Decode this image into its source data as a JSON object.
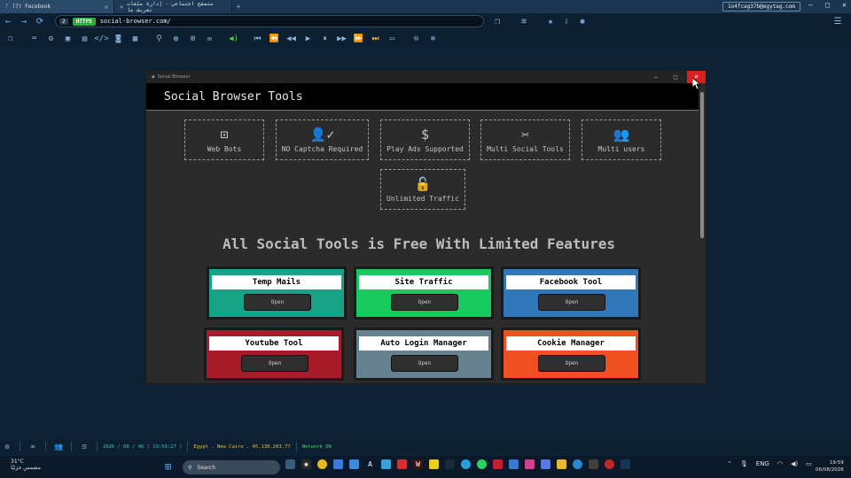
{
  "browser": {
    "tabs": [
      {
        "label": "(7) Facebook"
      },
      {
        "label": "متصفح اجتماعي - إدارة ملفات تعريف ما"
      }
    ],
    "new_tab": "+",
    "email": "1o4fcag37b@egytag.com",
    "url": {
      "tab_number": "2",
      "badge": "HTTPS",
      "text": "social-browser.com/"
    }
  },
  "window": {
    "app_name": "Social Browser",
    "header": "Social Browser Tools",
    "features": [
      {
        "icon": "robot-icon",
        "label": "Web Bots"
      },
      {
        "icon": "user-check-icon",
        "label": "NO Captcha Required"
      },
      {
        "icon": "dollar-file-icon",
        "label": "Play Ads Supported"
      },
      {
        "icon": "tools-icon",
        "label": "Multi Social Tools"
      },
      {
        "icon": "users-icon",
        "label": "Multi users"
      },
      {
        "icon": "unlock-icon",
        "label": "Unlimited Traffic"
      }
    ],
    "title": "All Social Tools is Free With Limited Features",
    "tools": [
      {
        "name": "Temp Mails",
        "button": "Open",
        "color": "#16a388"
      },
      {
        "name": "Site Traffic",
        "button": "Open",
        "color": "#18c95e"
      },
      {
        "name": "Facebook Tool",
        "button": "Open",
        "color": "#2f77b8"
      },
      {
        "name": "Youtube Tool",
        "button": "Open",
        "color": "#a81b2a"
      },
      {
        "name": "Auto Login Manager",
        "button": "Open",
        "color": "#65808f"
      },
      {
        "name": "Cookie Manager",
        "button": "Open",
        "color": "#f04f22"
      }
    ]
  },
  "status": {
    "datetime": "2026 / 08 / 06 ( 19:59:27 )",
    "location": "Egypt . New Cairo . 45.130.203.77",
    "network": "Network ON"
  },
  "taskbar": {
    "weather_temp": "31°C",
    "weather_desc": "مشمس جزئيًا",
    "search": "Search",
    "lang": "ENG",
    "time": "19:59",
    "date": "06/08/2026"
  }
}
